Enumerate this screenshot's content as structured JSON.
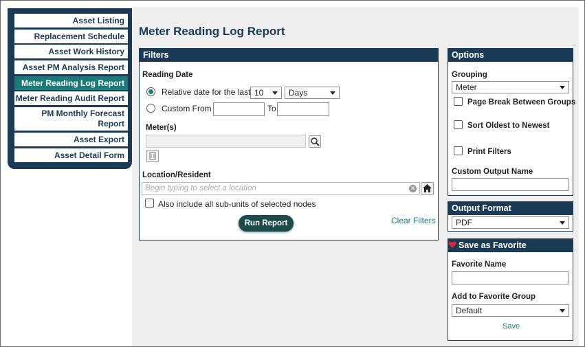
{
  "sidebar": {
    "items": [
      {
        "label": "Asset Listing"
      },
      {
        "label": "Replacement Schedule"
      },
      {
        "label": "Asset Work History"
      },
      {
        "label": "Asset PM Analysis Report"
      },
      {
        "label": "Meter Reading Log Report"
      },
      {
        "label": "Meter Reading Audit Report"
      },
      {
        "label": "PM Monthly Forecast Report"
      },
      {
        "label": "Asset Export"
      },
      {
        "label": "Asset Detail Form"
      }
    ],
    "active_index": 4
  },
  "page": {
    "title": "Meter Reading Log Report"
  },
  "filters": {
    "heading": "Filters",
    "reading_date_label": "Reading Date",
    "relative_label": "Relative date for the last",
    "relative_count": "10",
    "relative_unit": "Days",
    "custom_from_label": "Custom From",
    "to_label": "To",
    "meters_label": "Meter(s)",
    "location_label": "Location/Resident",
    "location_placeholder": "Begin typing to select a location",
    "subunits_label": "Also include all sub-units of selected nodes",
    "run_report_label": "Run Report",
    "clear_filters_label": "Clear Filters"
  },
  "options": {
    "heading": "Options",
    "grouping_label": "Grouping",
    "grouping_value": "Meter",
    "page_break_label": "Page Break Between Groups",
    "sort_oldest_label": "Sort Oldest to Newest",
    "print_filters_label": "Print Filters",
    "custom_output_label": "Custom Output Name"
  },
  "output": {
    "heading": "Output Format",
    "value": "PDF"
  },
  "favorite": {
    "heading": "Save as Favorite",
    "name_label": "Favorite Name",
    "group_label": "Add to Favorite Group",
    "group_value": "Default",
    "save_label": "Save"
  },
  "colors": {
    "navy": "#1b3a55",
    "teal": "#1a7a78",
    "heart": "#d9263a"
  }
}
